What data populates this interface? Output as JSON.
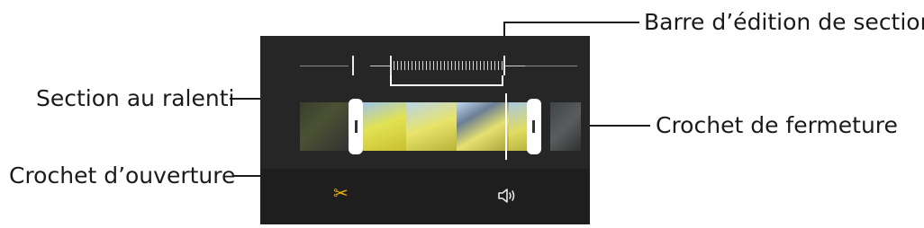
{
  "labels": {
    "section_edit_bar": "Barre d’édition de section",
    "slow_motion_section": "Section au ralenti",
    "end_bracket": "Crochet de fermeture",
    "start_bracket": "Crochet d’ouverture"
  },
  "toolbar": {
    "cut_icon": "scissors-icon",
    "sound_icon": "speaker-icon"
  },
  "colors": {
    "accent": "#f0b400",
    "screen_bg": "#262626",
    "toolbar_bg": "#1e1e1e"
  }
}
